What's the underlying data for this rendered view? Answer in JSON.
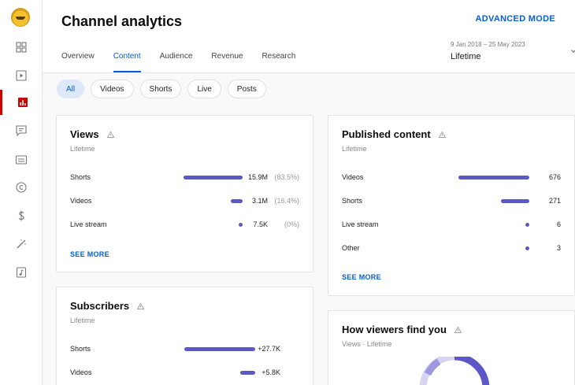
{
  "header": {
    "title": "Channel analytics",
    "advanced_mode": "ADVANCED MODE",
    "tabs": [
      {
        "label": "Overview"
      },
      {
        "label": "Content"
      },
      {
        "label": "Audience"
      },
      {
        "label": "Revenue"
      },
      {
        "label": "Research"
      }
    ],
    "active_tab": "Content",
    "date_range": "9 Jan 2018 – 25 May 2023",
    "date_range_value": "Lifetime"
  },
  "chips": [
    {
      "label": "All"
    },
    {
      "label": "Videos"
    },
    {
      "label": "Shorts"
    },
    {
      "label": "Live"
    },
    {
      "label": "Posts"
    }
  ],
  "sidebar": {
    "items": [
      {
        "icon": "dashboard-icon"
      },
      {
        "icon": "content-icon"
      },
      {
        "icon": "analytics-icon",
        "active": true
      },
      {
        "icon": "comments-icon"
      },
      {
        "icon": "subtitles-icon"
      },
      {
        "icon": "copyright-icon"
      },
      {
        "icon": "earn-icon"
      },
      {
        "icon": "customisation-icon"
      },
      {
        "icon": "audio-library-icon"
      }
    ]
  },
  "views_card": {
    "title": "Views",
    "subtitle": "Lifetime",
    "rows": [
      {
        "label": "Shorts",
        "value": "15.9M",
        "pct": "(83.5%)",
        "share": 0.835
      },
      {
        "label": "Videos",
        "value": "3.1M",
        "pct": "(16.4%)",
        "share": 0.164
      },
      {
        "label": "Live stream",
        "value": "7.5K",
        "pct": "(0%)",
        "share": 0.0
      }
    ],
    "see_more": "SEE MORE"
  },
  "published_card": {
    "title": "Published content",
    "subtitle": "Lifetime",
    "rows": [
      {
        "label": "Videos",
        "value": "676",
        "share": 1.0
      },
      {
        "label": "Shorts",
        "value": "271",
        "share": 0.4
      },
      {
        "label": "Live stream",
        "value": "6",
        "share": 0.0
      },
      {
        "label": "Other",
        "value": "3",
        "share": 0.0
      }
    ],
    "see_more": "SEE MORE"
  },
  "subscribers_card": {
    "title": "Subscribers",
    "subtitle": "Lifetime",
    "rows": [
      {
        "label": "Shorts",
        "value": "+27.7K",
        "share": 1.0
      },
      {
        "label": "Videos",
        "value": "+5.8K",
        "share": 0.21
      }
    ]
  },
  "viewers_card": {
    "title": "How viewers find you",
    "subtitle": "Views · Lifetime"
  },
  "colors": {
    "accent": "#065fd4",
    "bar": "#5d58c7",
    "active_rail": "#cc0000"
  }
}
